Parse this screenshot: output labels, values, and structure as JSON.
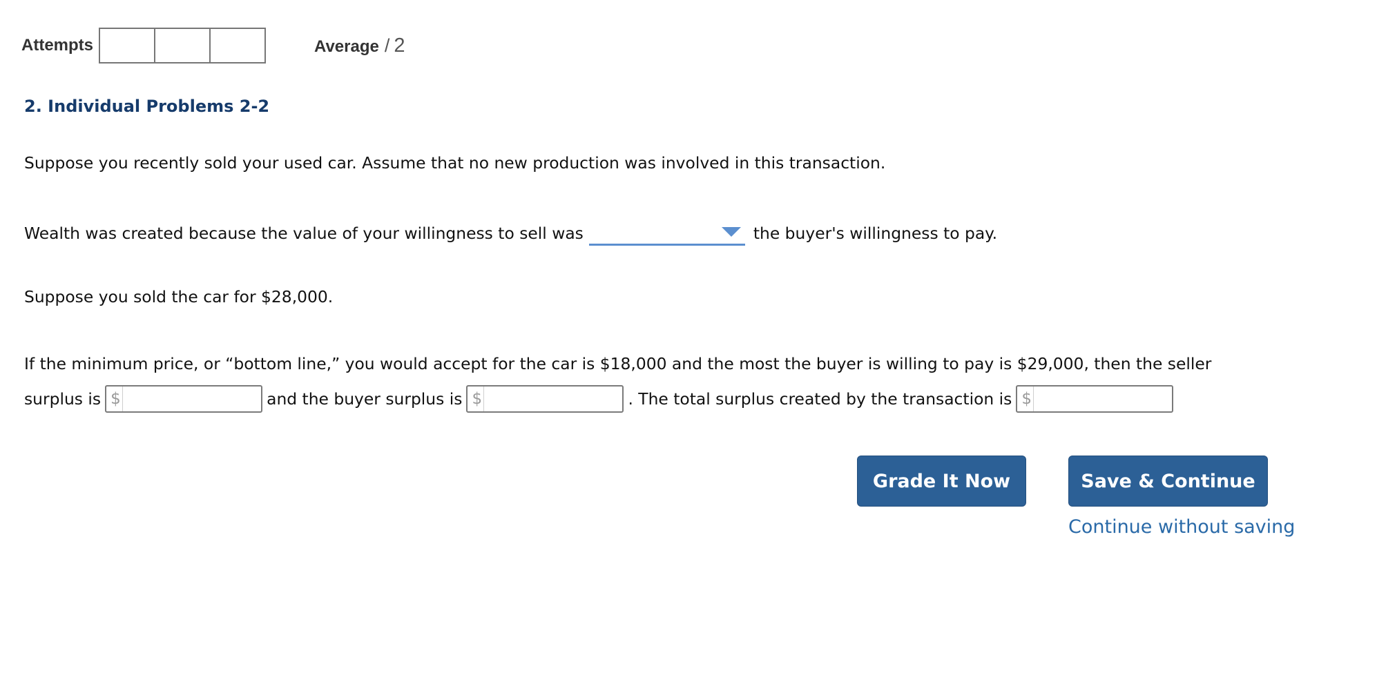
{
  "header": {
    "attempts_label": "Attempts",
    "attempt_boxes": [
      "",
      "",
      ""
    ],
    "average_label": "Average",
    "average_separator": "/",
    "average_total": "2"
  },
  "question": {
    "title": "2. Individual Problems 2-2",
    "intro": "Suppose you recently sold your used car. Assume that no new production was involved in this transaction.",
    "wealth_before": "Wealth was created because the value of your willingness to sell was",
    "wealth_dropdown_value": "",
    "wealth_after": "the buyer's willingness to pay.",
    "sold_text": "Suppose you sold the car for $28,000.",
    "surplus_line1": "If the minimum price, or “bottom line,” you would accept for the car is $18,000 and the most the buyer is willing to pay is $29,000, then the seller",
    "surplus_prefix": "surplus is",
    "buyer_text": "and the buyer surplus is",
    "total_text": ". The total surplus created by the transaction is",
    "currency_symbol": "$",
    "seller_surplus_value": "",
    "buyer_surplus_value": "",
    "total_surplus_value": ""
  },
  "actions": {
    "grade_label": "Grade It Now",
    "save_label": "Save & Continue",
    "continue_label": "Continue without saving"
  },
  "colors": {
    "title": "#163b6b",
    "button_bg": "#2c6096",
    "link": "#2a6aa8",
    "dropdown_accent": "#5b8fcf"
  }
}
